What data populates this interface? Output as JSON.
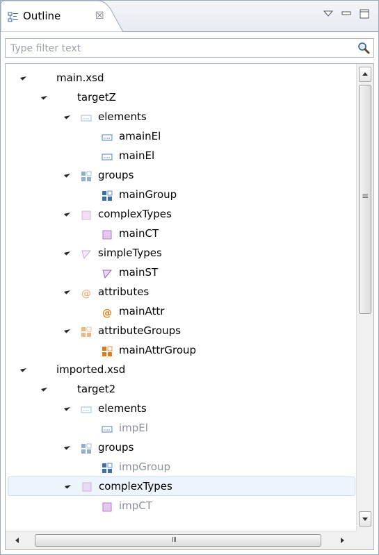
{
  "view": {
    "tab_title": "Outline",
    "close_glyph": "☒"
  },
  "filter": {
    "placeholder": "Type filter text",
    "value": ""
  },
  "colors": {
    "element": "#4a7fc1",
    "group": "#3a6fb0",
    "complex": "#b07cc0",
    "simple": "#9b6bb5",
    "attribute": "#e07a1a",
    "attr_group": "#e07a1a",
    "selected_row": "#eef4fb"
  },
  "tree": {
    "rows": [
      {
        "label": "main.xsd",
        "indent": 0,
        "icon": "none",
        "expanded": true,
        "dim": false
      },
      {
        "label": "targetZ",
        "indent": 1,
        "icon": "none",
        "expanded": true,
        "dim": false
      },
      {
        "label": "elements",
        "indent": 2,
        "icon": "element-icon",
        "expanded": true,
        "dim": false,
        "faded_icon": true
      },
      {
        "label": "amainEl",
        "indent": 3,
        "icon": "element-icon",
        "expanded": false,
        "dim": false
      },
      {
        "label": "mainEl",
        "indent": 3,
        "icon": "element-icon",
        "expanded": false,
        "dim": false
      },
      {
        "label": "groups",
        "indent": 2,
        "icon": "group-icon",
        "expanded": true,
        "dim": false,
        "faded_icon": true
      },
      {
        "label": "mainGroup",
        "indent": 3,
        "icon": "group-icon",
        "expanded": false,
        "dim": false
      },
      {
        "label": "complexTypes",
        "indent": 2,
        "icon": "complex-type-icon",
        "expanded": true,
        "dim": false,
        "faded_icon": true
      },
      {
        "label": "mainCT",
        "indent": 3,
        "icon": "complex-type-icon",
        "expanded": false,
        "dim": false
      },
      {
        "label": "simpleTypes",
        "indent": 2,
        "icon": "simple-type-icon",
        "expanded": true,
        "dim": false,
        "faded_icon": true
      },
      {
        "label": "mainST",
        "indent": 3,
        "icon": "simple-type-icon",
        "expanded": false,
        "dim": false
      },
      {
        "label": "attributes",
        "indent": 2,
        "icon": "attribute-icon",
        "expanded": true,
        "dim": false,
        "faded_icon": true
      },
      {
        "label": "mainAttr",
        "indent": 3,
        "icon": "attribute-icon",
        "expanded": false,
        "dim": false
      },
      {
        "label": "attributeGroups",
        "indent": 2,
        "icon": "attribute-group-icon",
        "expanded": true,
        "dim": false,
        "faded_icon": true
      },
      {
        "label": "mainAttrGroup",
        "indent": 3,
        "icon": "attribute-group-icon",
        "expanded": false,
        "dim": false
      },
      {
        "label": "imported.xsd",
        "indent": 0,
        "icon": "none",
        "expanded": true,
        "dim": false
      },
      {
        "label": "target2",
        "indent": 1,
        "icon": "none",
        "expanded": true,
        "dim": false
      },
      {
        "label": "elements",
        "indent": 2,
        "icon": "element-icon",
        "expanded": true,
        "dim": false,
        "faded_icon": true
      },
      {
        "label": "impEl",
        "indent": 3,
        "icon": "element-icon",
        "expanded": false,
        "dim": true
      },
      {
        "label": "groups",
        "indent": 2,
        "icon": "group-icon",
        "expanded": true,
        "dim": false,
        "faded_icon": true
      },
      {
        "label": "impGroup",
        "indent": 3,
        "icon": "group-icon",
        "expanded": false,
        "dim": true
      },
      {
        "label": "complexTypes",
        "indent": 2,
        "icon": "complex-type-icon",
        "expanded": true,
        "dim": false,
        "faded_icon": true,
        "selected": true
      },
      {
        "label": "impCT",
        "indent": 3,
        "icon": "complex-type-icon",
        "expanded": false,
        "dim": true
      }
    ]
  },
  "scrollbars": {
    "horizontal_thumb_glyph": "III",
    "vertical_thumb_glyph": "≡"
  }
}
